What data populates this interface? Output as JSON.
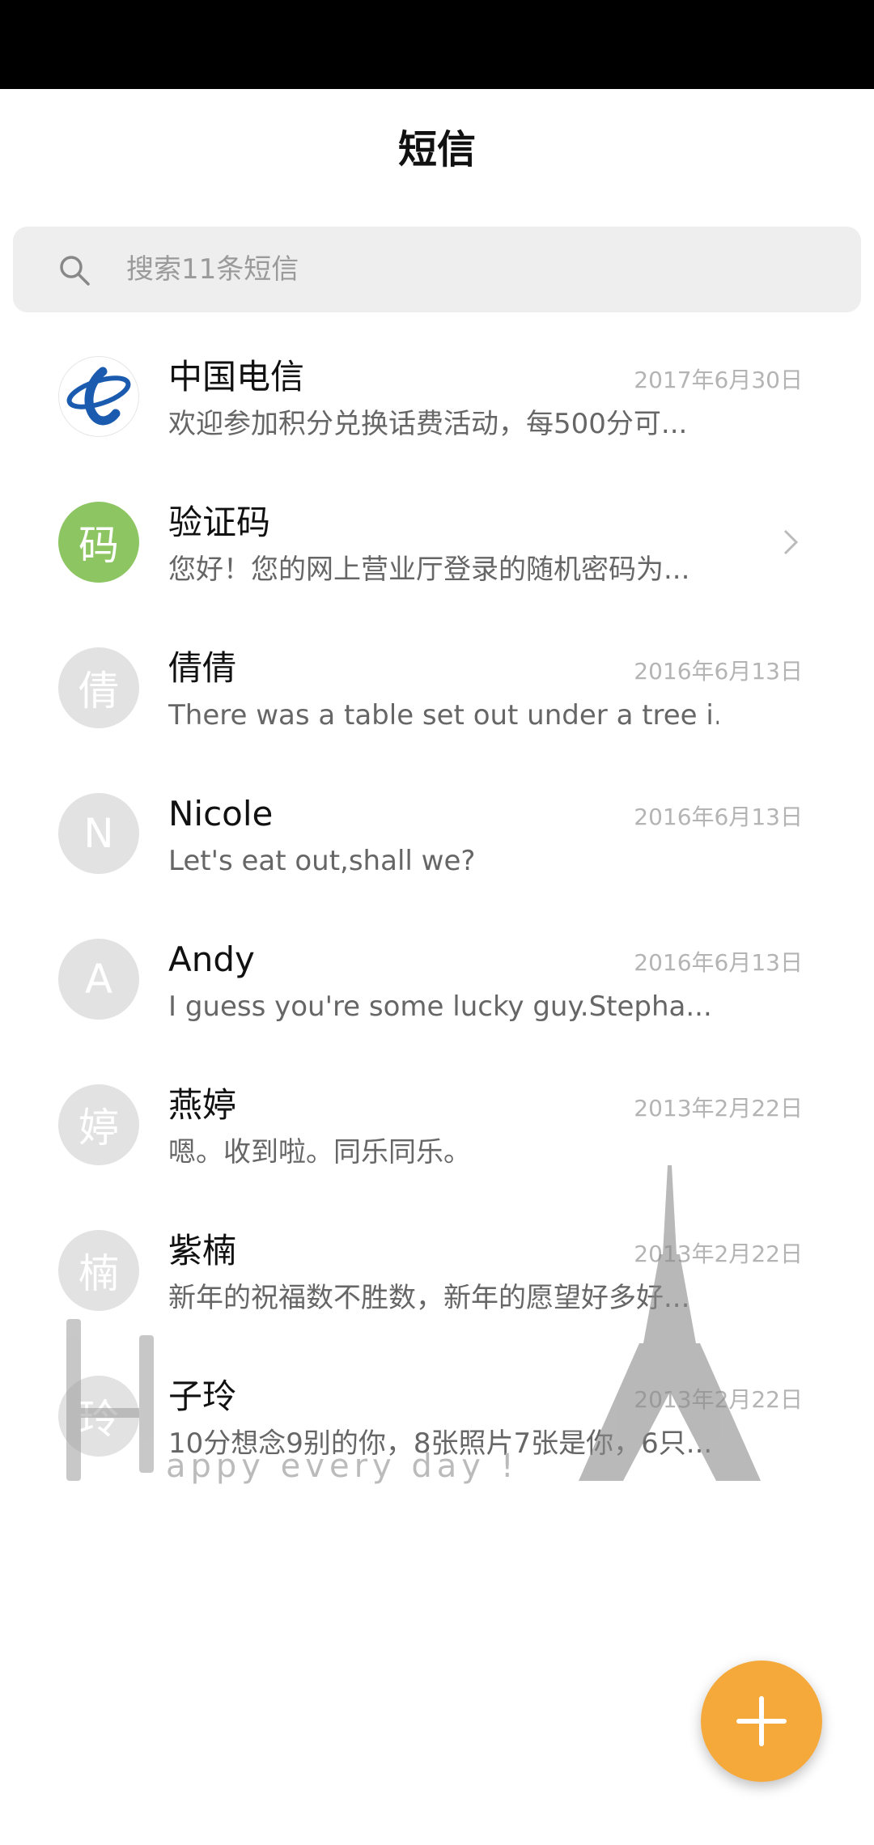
{
  "header": {
    "title": "短信"
  },
  "search": {
    "placeholder": "搜索11条短信",
    "icon": "search-icon"
  },
  "conversations": [
    {
      "name": "中国电信",
      "date": "2017年6月30日",
      "preview": "欢迎参加积分兑换话费活动，每500分可...",
      "avatar": "telecom-logo",
      "avatar_text": ""
    },
    {
      "name": "验证码",
      "date": "",
      "preview": "您好！您的网上营业厅登录的随机密码为...",
      "avatar": "green",
      "avatar_text": "码"
    },
    {
      "name": "倩倩",
      "date": "2016年6月13日",
      "preview": "There was a table set out under a tree i...",
      "avatar": "gray",
      "avatar_text": "倩"
    },
    {
      "name": "Nicole",
      "date": "2016年6月13日",
      "preview": "Let's eat out,shall we?",
      "avatar": "gray",
      "avatar_text": "N"
    },
    {
      "name": "Andy",
      "date": "2016年6月13日",
      "preview": "I guess you're some lucky guy.Stepha...",
      "avatar": "gray",
      "avatar_text": "A"
    },
    {
      "name": "燕婷",
      "date": "2013年2月22日",
      "preview": "嗯。收到啦。同乐同乐。",
      "avatar": "gray",
      "avatar_text": "婷"
    },
    {
      "name": "紫楠",
      "date": "2013年2月22日",
      "preview": "新年的祝福数不胜数，新年的愿望好多好...",
      "avatar": "gray",
      "avatar_text": "楠"
    },
    {
      "name": "子玲",
      "date": "2013年2月22日",
      "preview": "10分想念9别的你，8张照片7张是你，6只...",
      "avatar": "gray",
      "avatar_text": "玲"
    }
  ],
  "watermark": {
    "text": "appy every day !"
  },
  "colors": {
    "accent": "#f5a93b",
    "green_avatar": "#8cc561",
    "gray_avatar": "#e2e2e2"
  }
}
